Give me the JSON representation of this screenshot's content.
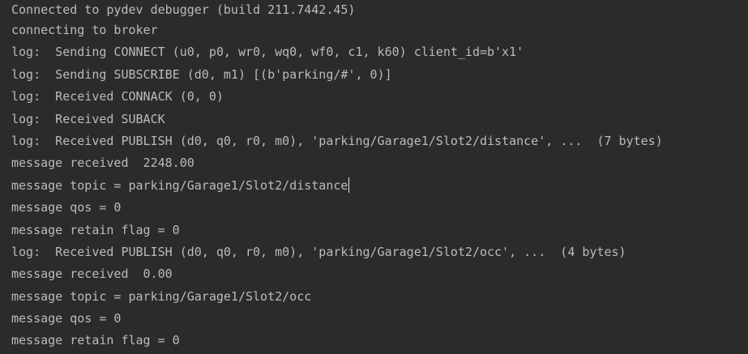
{
  "console": {
    "lines": [
      "Connected to pydev debugger (build 211.7442.45)",
      "connecting to broker",
      "log:  Sending CONNECT (u0, p0, wr0, wq0, wf0, c1, k60) client_id=b'x1'",
      "log:  Sending SUBSCRIBE (d0, m1) [(b'parking/#', 0)]",
      "log:  Received CONNACK (0, 0)",
      "log:  Received SUBACK",
      "log:  Received PUBLISH (d0, q0, r0, m0), 'parking/Garage1/Slot2/distance', ...  (7 bytes)",
      "message received  2248.00",
      "message topic = parking/Garage1/Slot2/distance",
      "message qos = 0",
      "message retain flag = 0",
      "log:  Received PUBLISH (d0, q0, r0, m0), 'parking/Garage1/Slot2/occ', ...  (4 bytes)",
      "message received  0.00",
      "message topic = parking/Garage1/Slot2/occ",
      "message qos = 0",
      "message retain flag = 0"
    ]
  },
  "colors": {
    "background": "#2b2b2b",
    "text": "#bbbbbb",
    "caret": "#e6e6e6"
  }
}
